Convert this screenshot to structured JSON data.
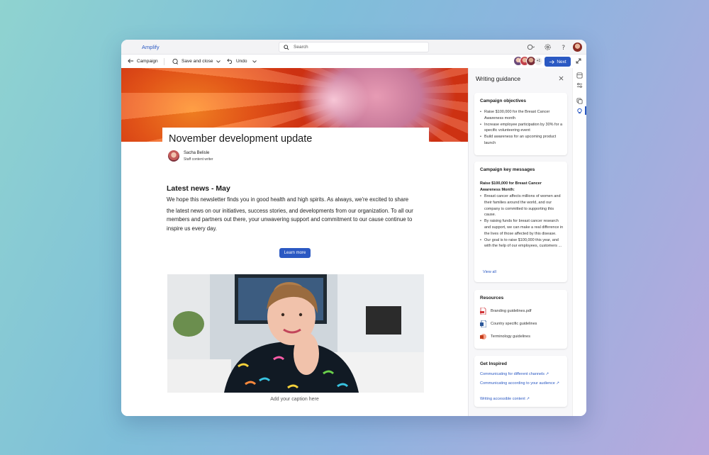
{
  "app": {
    "name": "Amplify"
  },
  "search": {
    "placeholder": "Search"
  },
  "toolbar": {
    "back_label": "Campaign",
    "save_label": "Save and close",
    "undo_label": "Undo",
    "collaborators_extra": "+1",
    "next_label": "Next"
  },
  "document": {
    "headline": "November development update",
    "author_name": "Sacha Belisle",
    "author_role": "Staff content writer",
    "section_heading": "Latest news - May",
    "paragraph_1": "We hope this newsletter finds you in good health and high spirits. As always, we're excited to share",
    "paragraph_2": "the latest news on our initiatives, success stories, and developments from our organization. To all our members and partners out there, your unwavering support and commitment to our cause continue to inspire us every day.",
    "cta_label": "Learn more",
    "image_caption": "Add your caption here"
  },
  "guidance": {
    "title": "Writing guidance",
    "objectives": {
      "title": "Campaign objectives",
      "items": [
        "Raise $100,000 for the Breast Cancer Awareness month",
        "Increase employee participation by 30% for a specific volunteering event",
        "Build awareness for an upcoming product launch"
      ]
    },
    "key_messages": {
      "title": "Campaign key messages",
      "subtitle": "Raise $100,000 for Breast Cancer Awareness Month:",
      "items": [
        "Breast cancer affects millions of women and their families around the world, and our company is committed to supporting this cause.",
        "By raising funds for breast cancer research and support, we can make a real difference in the lives of those affected by this disease.",
        "Our goal is to raise $100,000 this year, and with the help of our employees, customers ..."
      ],
      "view_all": "View all"
    },
    "resources": {
      "title": "Resources",
      "items": [
        {
          "label": "Branding guidelines.pdf",
          "icon": "pdf-icon"
        },
        {
          "label": "Country specific guidelines",
          "icon": "word-doc-icon"
        },
        {
          "label": "Terminology guidelines",
          "icon": "powerpoint-icon"
        }
      ]
    },
    "inspired": {
      "title": "Get Inspired",
      "links": [
        "Communicating for different channels",
        "Communicating according to your audience",
        "Writing accessible content"
      ]
    }
  },
  "colors": {
    "accent": "#2b59c3",
    "pdf": "#d13438",
    "word": "#2b579a",
    "powerpoint": "#c43e1c"
  }
}
